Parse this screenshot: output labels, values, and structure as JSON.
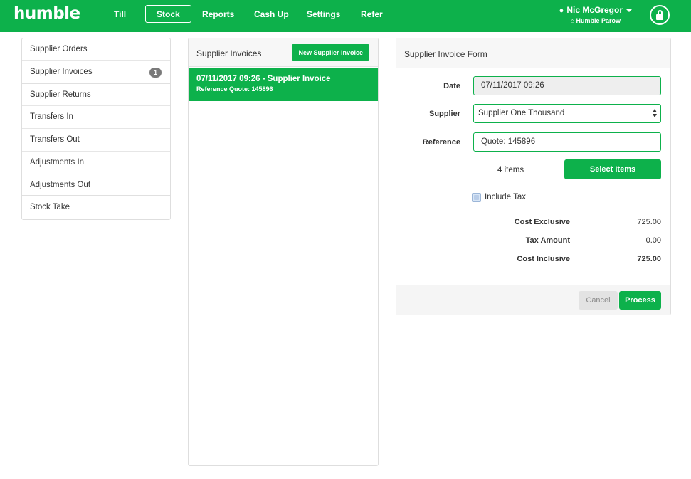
{
  "app": {
    "logo": "humble"
  },
  "nav": {
    "items": [
      {
        "label": "Till"
      },
      {
        "label": "Stock"
      },
      {
        "label": "Reports"
      },
      {
        "label": "Cash Up"
      },
      {
        "label": "Settings"
      },
      {
        "label": "Refer"
      }
    ],
    "active": "Stock"
  },
  "user": {
    "name": "Nic McGregor",
    "store": "Humble Parow"
  },
  "sidebar": {
    "items": [
      {
        "label": "Supplier Orders"
      },
      {
        "label": "Supplier Invoices",
        "badge": "1"
      },
      {
        "label": "Supplier Returns"
      },
      {
        "label": "Transfers In"
      },
      {
        "label": "Transfers Out"
      },
      {
        "label": "Adjustments In"
      },
      {
        "label": "Adjustments Out"
      },
      {
        "label": "Stock Take"
      }
    ]
  },
  "invoices_panel": {
    "title": "Supplier Invoices",
    "new_button": "New Supplier Invoice",
    "rows": [
      {
        "title": "07/11/2017 09:26 - Supplier Invoice",
        "subtitle": "Reference Quote: 145896"
      }
    ]
  },
  "form": {
    "title": "Supplier Invoice Form",
    "date_label": "Date",
    "date_value": "07/11/2017 09:26",
    "supplier_label": "Supplier",
    "supplier_value": "Supplier One Thousand",
    "reference_label": "Reference",
    "reference_value": "Quote: 145896",
    "items_count": "4 items",
    "select_items_button": "Select Items",
    "include_tax_label": "Include Tax",
    "cost_exclusive_label": "Cost Exclusive",
    "cost_exclusive_value": "725.00",
    "tax_amount_label": "Tax Amount",
    "tax_amount_value": "0.00",
    "cost_inclusive_label": "Cost Inclusive",
    "cost_inclusive_value": "725.00",
    "cancel_button": "Cancel",
    "process_button": "Process"
  },
  "colors": {
    "brand_green": "#0db14b",
    "badge_gray": "#7a7a7a"
  }
}
